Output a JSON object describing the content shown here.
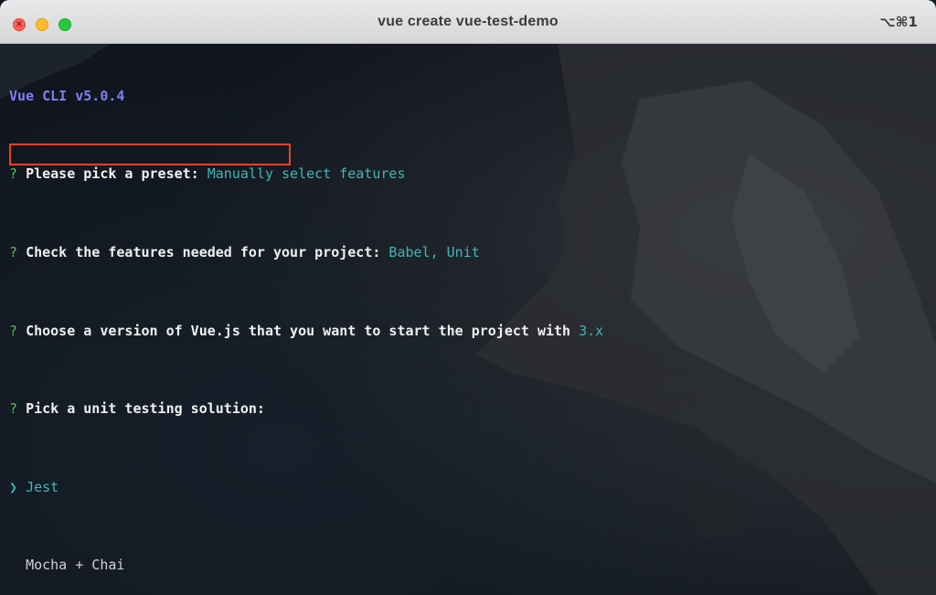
{
  "window": {
    "title": "vue create vue-test-demo",
    "shortcut": "⌥⌘1"
  },
  "terminal": {
    "header": "Vue CLI v5.0.4",
    "prompts": [
      {
        "mark": "?",
        "question": "Please pick a preset: ",
        "answer": "Manually select features"
      },
      {
        "mark": "?",
        "question": "Check the features needed for your project: ",
        "answer": "Babel, Unit"
      },
      {
        "mark": "?",
        "question": "Choose a version of Vue.js that you want to start the project with ",
        "answer": "3.x"
      },
      {
        "mark": "?",
        "question": "Pick a unit testing solution:",
        "answer": ""
      }
    ],
    "options": [
      {
        "pointer": "❯",
        "label": "Jest",
        "selected": true
      },
      {
        "pointer": " ",
        "label": "Mocha + Chai",
        "selected": false
      }
    ]
  },
  "colors": {
    "header": "#7f7ff5",
    "question_mark": "#4bc24b",
    "answer": "#3fb6b6",
    "highlight_box": "#e7422a"
  }
}
